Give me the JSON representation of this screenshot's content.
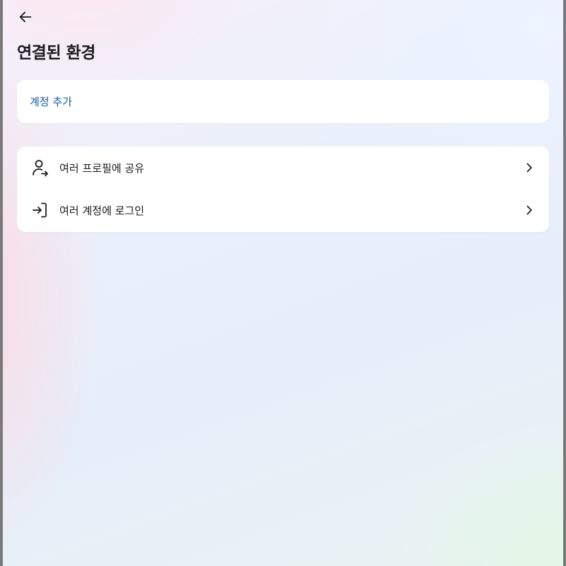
{
  "header": {
    "back_icon": "arrow-left-icon",
    "title": "연결된 환경"
  },
  "add_card": {
    "label": "계정 추가",
    "color": "#0b5fa5"
  },
  "options": [
    {
      "icon": "person-share-icon",
      "label": "여러 프로필에 공유",
      "trailing_icon": "chevron-right-icon"
    },
    {
      "icon": "login-icon",
      "label": "여러 계정에 로그인",
      "trailing_icon": "chevron-right-icon"
    }
  ]
}
